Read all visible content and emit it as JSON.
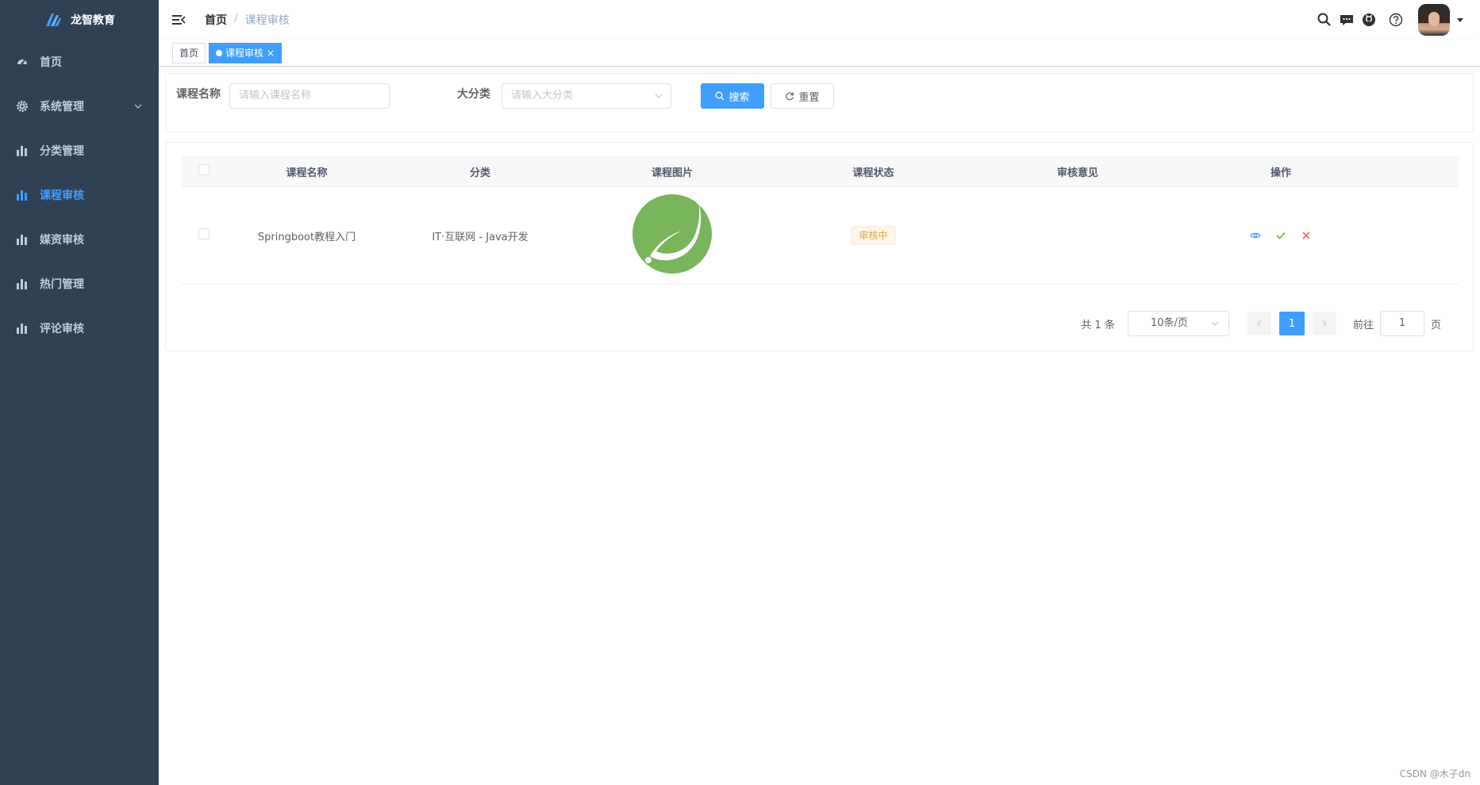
{
  "app": {
    "name": "龙智教育"
  },
  "sidebar": {
    "items": [
      {
        "label": "首页",
        "icon": "dashboard-icon"
      },
      {
        "label": "系统管理",
        "icon": "gear-icon"
      },
      {
        "label": "分类管理",
        "icon": "bar-chart-icon"
      },
      {
        "label": "课程审核",
        "icon": "bar-chart-icon",
        "active": true
      },
      {
        "label": "媒资审核",
        "icon": "bar-chart-icon"
      },
      {
        "label": "热门管理",
        "icon": "bar-chart-icon"
      },
      {
        "label": "评论审核",
        "icon": "bar-chart-icon"
      }
    ]
  },
  "navbar": {
    "breadcrumb": {
      "home": "首页",
      "separator": "/",
      "current": "课程审核"
    }
  },
  "tags": [
    {
      "label": "首页"
    },
    {
      "label": "课程审核",
      "active": true,
      "close": "×"
    }
  ],
  "search": {
    "course_name_label": "课程名称",
    "course_name_placeholder": "请输入课程名称",
    "category_label": "大分类",
    "category_placeholder": "请输入大分类",
    "search_button": "搜索",
    "reset_button": "重置"
  },
  "table": {
    "headers": [
      "课程名称",
      "分类",
      "课程图片",
      "课程状态",
      "审核意见",
      "操作"
    ],
    "rows": [
      {
        "name": "Springboot教程入门",
        "category": "IT·互联网 - Java开发",
        "image": "spring-leaf-logo",
        "status": "审核中",
        "opinion": ""
      }
    ]
  },
  "pagination": {
    "total": "共 1 条",
    "page_size": "10条/页",
    "current_page": "1",
    "goto_label": "前往",
    "goto_value": "1",
    "page_suffix": "页"
  },
  "watermark": "CSDN @木子dn",
  "colors": {
    "sidebar_bg": "#304156",
    "primary": "#409eff",
    "warning": "#e6a23c",
    "success": "#67c23a",
    "danger": "#f56c6c"
  }
}
